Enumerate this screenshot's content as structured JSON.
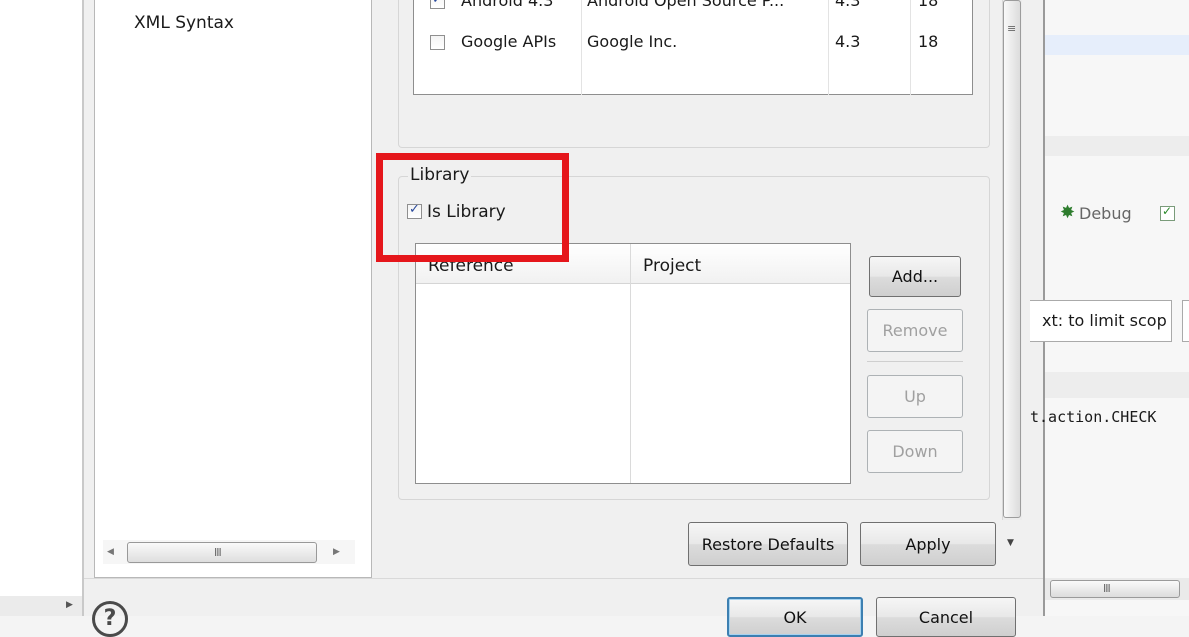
{
  "tree": {
    "items": [
      "XML Syntax"
    ]
  },
  "build_target": {
    "rows": [
      {
        "checked": true,
        "name": "Android 4.3",
        "vendor": "Android Open Source P...",
        "platform": "4.3",
        "api": "18"
      },
      {
        "checked": false,
        "name": "Google APIs",
        "vendor": "Google Inc.",
        "platform": "4.3",
        "api": "18"
      }
    ]
  },
  "library": {
    "group_title": "Library",
    "is_library_label": "Is Library",
    "is_library_checked": true,
    "columns": [
      "Reference",
      "Project"
    ],
    "buttons": {
      "add": "Add...",
      "remove": "Remove",
      "up": "Up",
      "down": "Down"
    }
  },
  "page_buttons": {
    "restore_defaults": "Restore Defaults",
    "apply": "Apply"
  },
  "dialog_buttons": {
    "ok": "OK",
    "cancel": "Cancel"
  },
  "background_editor": {
    "debug_label": "Debug",
    "filter_text": "xt: to limit scop",
    "code_line": "t.action.CHECK"
  },
  "annotation": {
    "color": "#e5161b"
  }
}
